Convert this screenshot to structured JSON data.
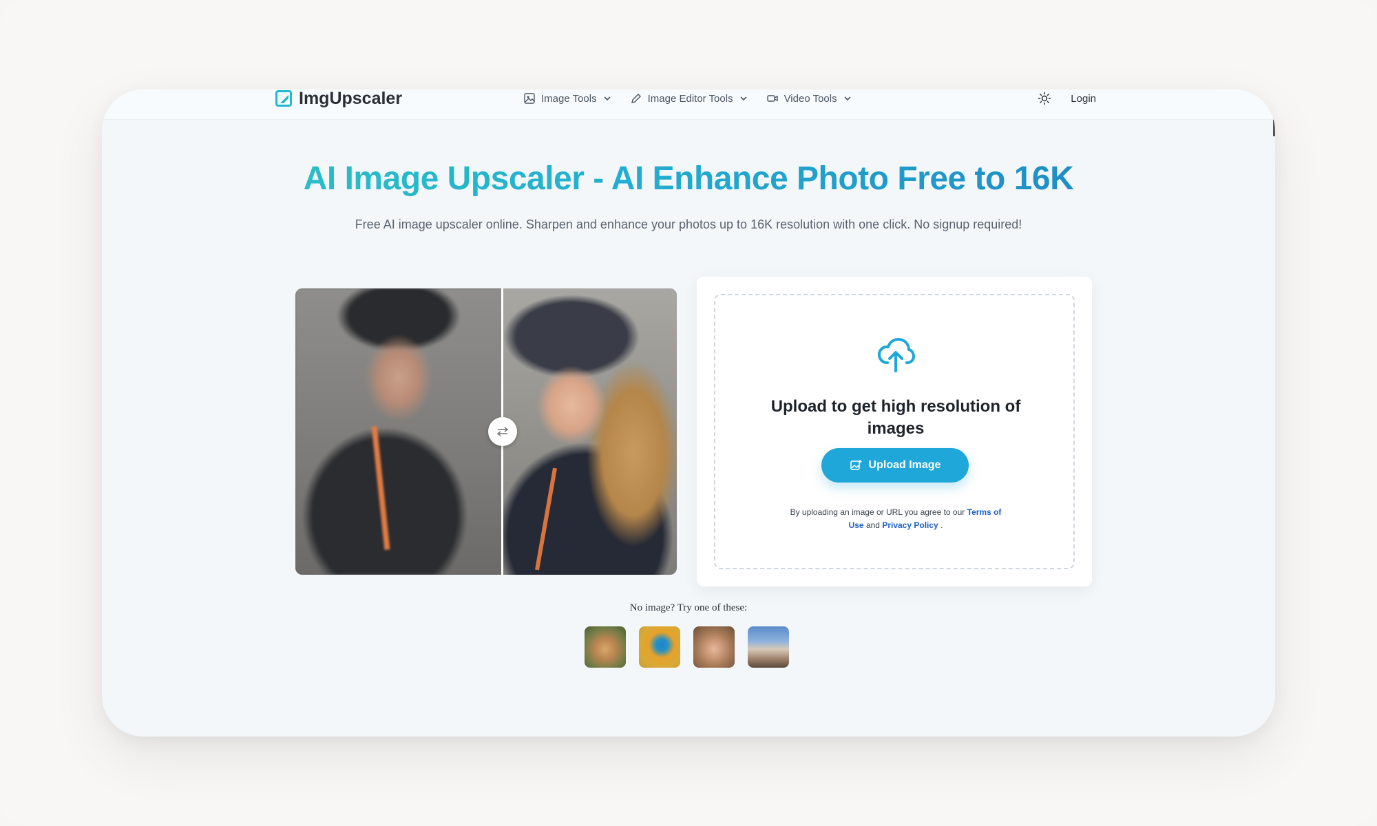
{
  "navbar": {
    "logo_text": "ImgUpscaler",
    "menu": [
      {
        "label": "Image Tools",
        "icon": "image-icon"
      },
      {
        "label": "Image Editor Tools",
        "icon": "pencil-icon"
      },
      {
        "label": "Video Tools",
        "icon": "video-camera-icon"
      }
    ],
    "theme_icon": "sun-icon",
    "login_label": "Login"
  },
  "hero": {
    "title": "AI Image Upscaler - AI Enhance Photo Free to 16K",
    "subtitle": "Free AI image upscaler online. Sharpen and enhance your photos up to 16K resolution with one click. No signup required!"
  },
  "upload": {
    "icon": "cloud-upload-icon",
    "heading": "Upload to get high resolution of images",
    "button_label": "Upload Image",
    "terms_prefix": "By uploading an image or URL you agree to our",
    "terms_link": "Terms of Use",
    "terms_and": "and",
    "privacy_link": "Privacy Policy",
    "terms_suffix": "."
  },
  "samples": {
    "label": "No image? Try one of these:",
    "items": [
      "dog",
      "bird",
      "woman",
      "building"
    ]
  },
  "colors": {
    "accent": "#1ea7d8",
    "title_gradient_start": "#2ec7c0",
    "title_gradient_end": "#1e7fc0",
    "link": "#1e5fc2"
  }
}
